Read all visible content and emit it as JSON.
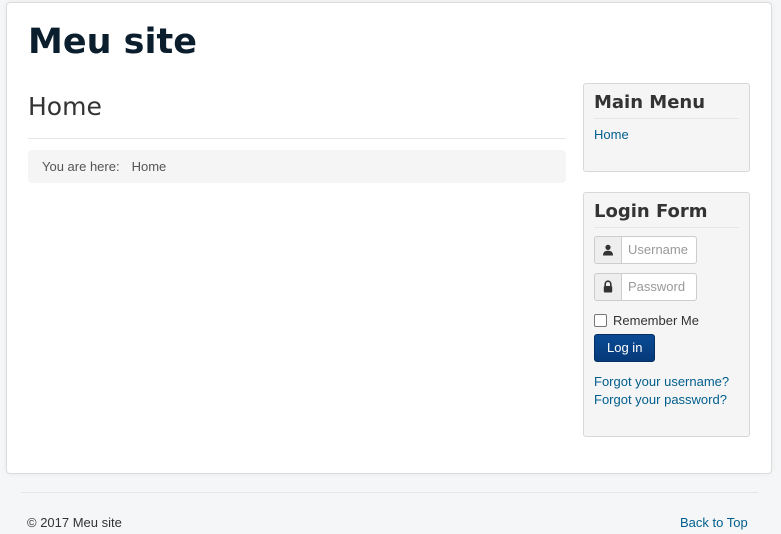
{
  "header": {
    "site_title": "Meu site"
  },
  "main": {
    "page_title": "Home",
    "breadcrumb": {
      "label": "You are here:",
      "current": "Home"
    }
  },
  "sidebar": {
    "main_menu": {
      "title": "Main Menu",
      "items": [
        {
          "label": "Home"
        }
      ]
    },
    "login_form": {
      "title": "Login Form",
      "username_placeholder": "Username",
      "password_placeholder": "Password",
      "remember_label": "Remember Me",
      "login_button": "Log in",
      "forgot_username": "Forgot your username?",
      "forgot_password": "Forgot your password?"
    }
  },
  "footer": {
    "copyright": "© 2017 Meu site",
    "back_to_top": "Back to Top"
  },
  "icons": {
    "username": "user-icon",
    "password": "lock-icon"
  },
  "colors": {
    "link": "#005e8d",
    "button": "#0a4a93",
    "brand": "#0b1e2e"
  }
}
